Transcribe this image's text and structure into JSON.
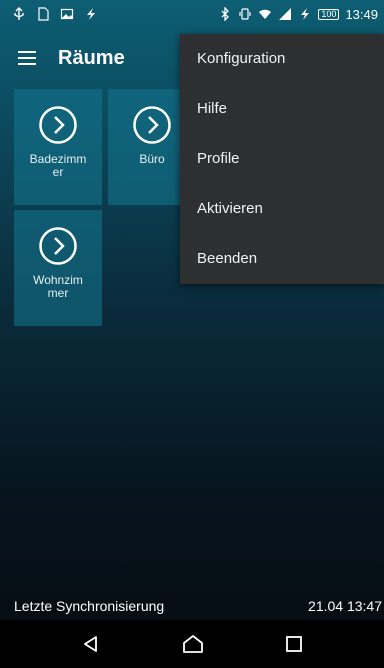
{
  "status_bar": {
    "left_icons": [
      "usb-icon",
      "file-icon",
      "image-icon",
      "flash-icon"
    ],
    "right_icons": [
      "bluetooth-icon",
      "vibrate-icon",
      "wifi-icon",
      "signal-icon",
      "charging-icon"
    ],
    "battery": "100",
    "time": "13:49"
  },
  "app_bar": {
    "title": "Räume",
    "menu_icon": "hamburger-menu-icon"
  },
  "rooms": [
    {
      "label": "Badezimm\ner",
      "icon": "chevron-right-circle-icon"
    },
    {
      "label": "Büro",
      "icon": "chevron-right-circle-icon"
    },
    {
      "label": "Wohnzim\nmer",
      "icon": "chevron-right-circle-icon"
    }
  ],
  "overflow_menu": {
    "items": [
      "Konfiguration",
      "Hilfe",
      "Profile",
      "Aktivieren",
      "Beenden"
    ]
  },
  "sync": {
    "label": "Letzte Synchronisierung",
    "timestamp": "21.04 13:47"
  },
  "nav_bar": {
    "icons": [
      "back-icon",
      "home-icon",
      "recents-icon"
    ]
  },
  "colors": {
    "tile": "#14788f",
    "menu_bg": "#2e2f31",
    "nav_bg": "#000000"
  }
}
